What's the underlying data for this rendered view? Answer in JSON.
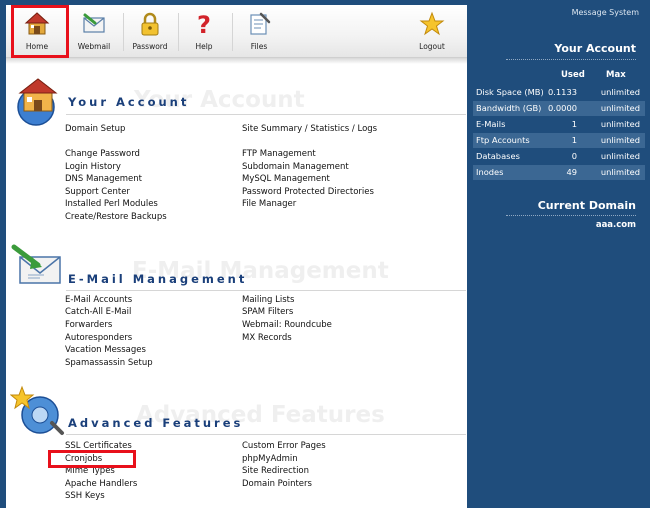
{
  "toolbar": {
    "items": [
      {
        "label": "Home",
        "icon": "home-icon"
      },
      {
        "label": "Webmail",
        "icon": "webmail-icon"
      },
      {
        "label": "Password",
        "icon": "lock-icon"
      },
      {
        "label": "Help",
        "icon": "help-icon"
      },
      {
        "label": "Files",
        "icon": "files-icon"
      },
      {
        "label": "Logout",
        "icon": "star-icon"
      }
    ]
  },
  "highlight_color": "#e8101b",
  "sections": {
    "account": {
      "title": "Your Account",
      "ghost": "Your Account",
      "left_links": [
        "Domain Setup",
        "Change Password",
        "Login History",
        "DNS Management",
        "Support Center",
        "Installed Perl Modules",
        "Create/Restore Backups"
      ],
      "right_links": [
        "Site Summary / Statistics / Logs",
        "FTP Management",
        "Subdomain Management",
        "MySQL Management",
        "Password Protected Directories",
        "File Manager"
      ]
    },
    "email": {
      "title": "E-Mail Management",
      "ghost": "E-Mail Management",
      "left_links": [
        "E-Mail Accounts",
        "Catch-All E-Mail",
        "Forwarders",
        "Autoresponders",
        "Vacation Messages",
        "Spamassassin Setup"
      ],
      "right_links": [
        "Mailing Lists",
        "SPAM Filters",
        "Webmail: Roundcube",
        "MX Records"
      ]
    },
    "advanced": {
      "title": "Advanced Features",
      "ghost": "Advanced Features",
      "left_links": [
        "SSL Certificates",
        "Cronjobs",
        "Mime Types",
        "Apache Handlers",
        "SSH Keys"
      ],
      "right_links": [
        "Custom Error Pages",
        "phpMyAdmin",
        "Site Redirection",
        "Domain Pointers"
      ]
    }
  },
  "sidebar": {
    "message_system": "Message System",
    "your_account_title": "Your Account",
    "col_used": "Used",
    "col_max": "Max",
    "stats": [
      {
        "label": "Disk Space (MB)",
        "used": "0.1133",
        "max": "unlimited"
      },
      {
        "label": "Bandwidth (GB)",
        "used": "0.0000",
        "max": "unlimited"
      },
      {
        "label": "E-Mails",
        "used": "1",
        "max": "unlimited"
      },
      {
        "label": "Ftp Accounts",
        "used": "1",
        "max": "unlimited"
      },
      {
        "label": "Databases",
        "used": "0",
        "max": "unlimited"
      },
      {
        "label": "Inodes",
        "used": "49",
        "max": "unlimited"
      }
    ],
    "current_domain_title": "Current Domain",
    "current_domain": "aaa.com"
  }
}
